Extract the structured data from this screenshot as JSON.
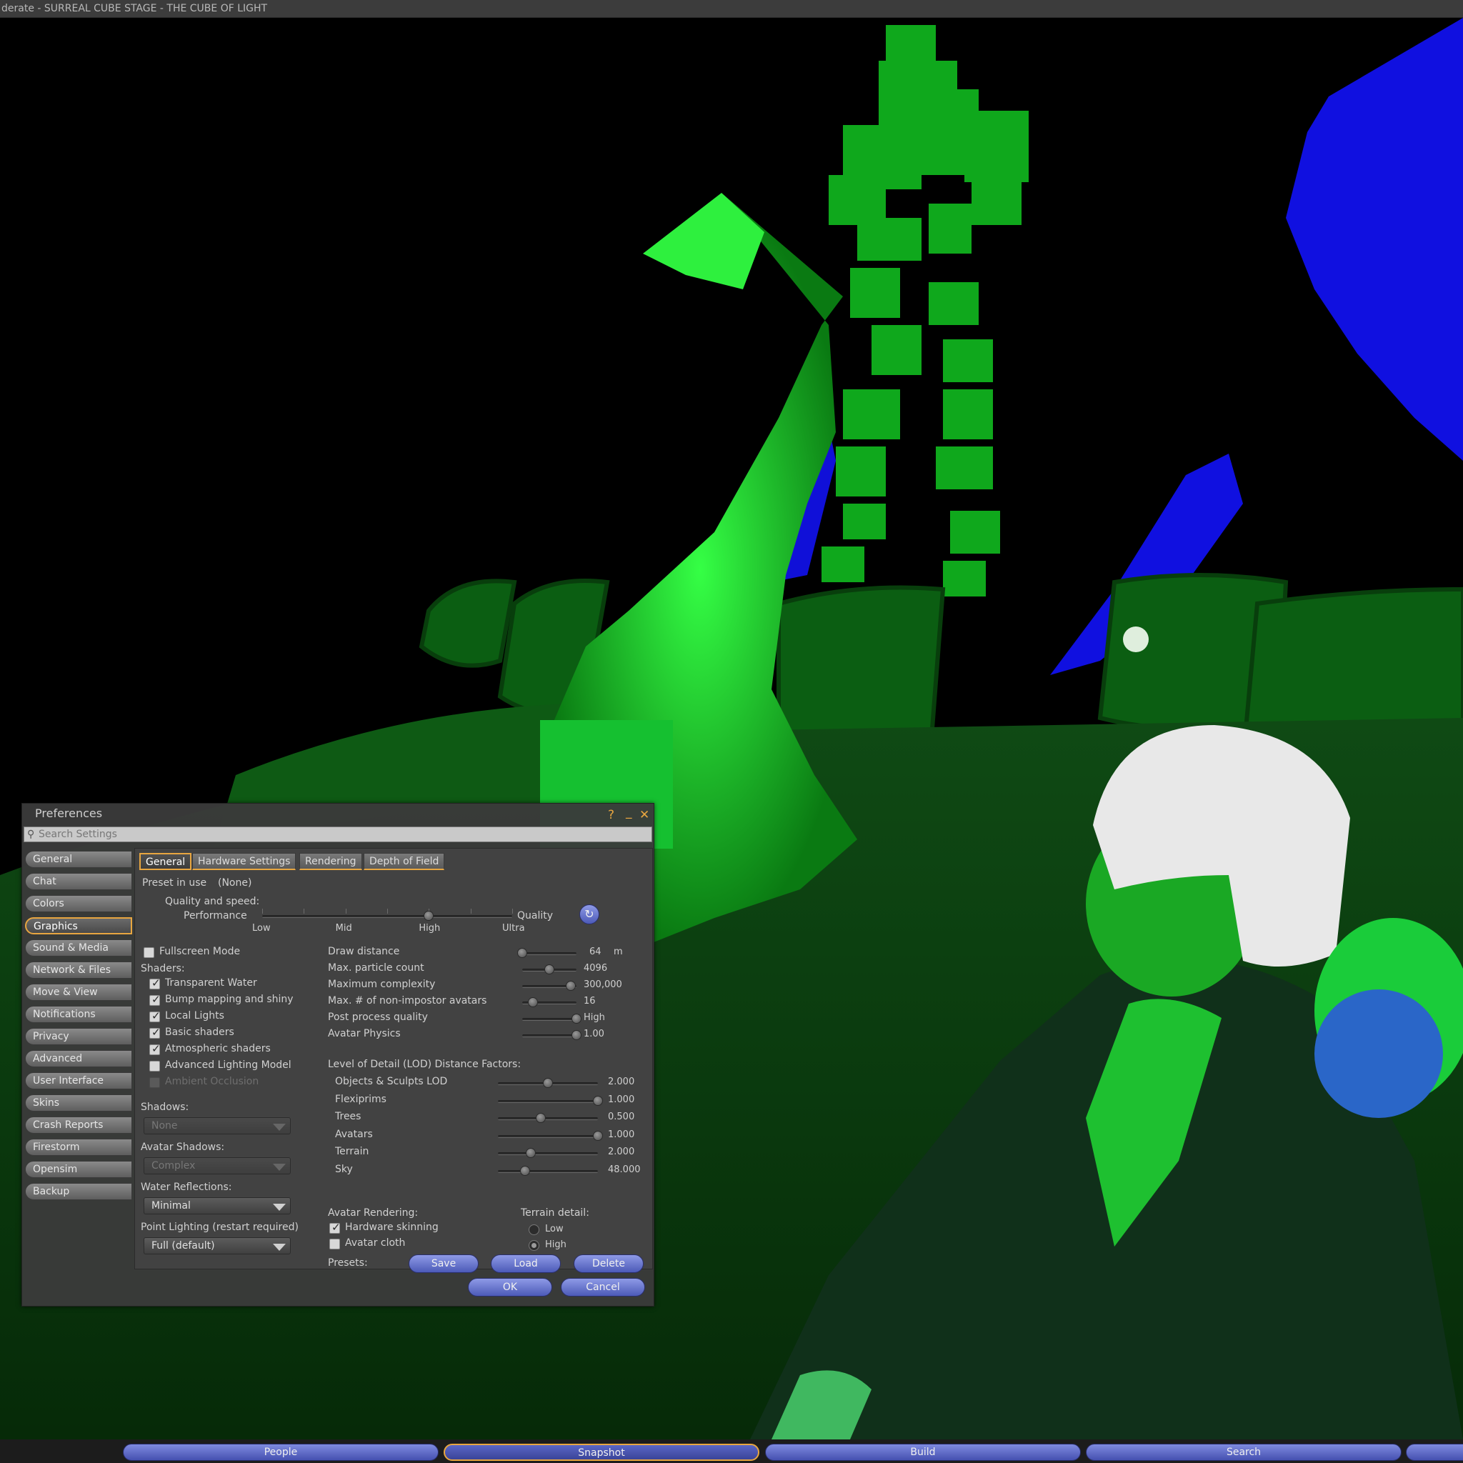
{
  "window": {
    "title": "derate - SURREAL CUBE STAGE - THE CUBE OF LIGHT"
  },
  "prefs": {
    "title": "Preferences",
    "help": "?",
    "minimize": "_",
    "close": "✕",
    "search_placeholder": "Search Settings",
    "sidebar": [
      "General",
      "Chat",
      "Colors",
      "Graphics",
      "Sound & Media",
      "Network & Files",
      "Move & View",
      "Notifications",
      "Privacy",
      "Advanced",
      "User Interface",
      "Skins",
      "Crash Reports",
      "Firestorm",
      "Opensim",
      "Backup"
    ],
    "sidebar_active": "Graphics",
    "tabs": [
      "General",
      "Hardware Settings",
      "Rendering",
      "Depth of Field"
    ],
    "tab_active": "General",
    "preset_label": "Preset in use",
    "preset_value": "(None)",
    "quality": {
      "label": "Quality and speed:",
      "left": "Performance",
      "right": "Quality",
      "ticks": [
        "Low",
        "Mid",
        "High",
        "Ultra"
      ],
      "level": 4,
      "max": 6
    },
    "fullscreen": {
      "label": "Fullscreen Mode",
      "checked": false
    },
    "shaders_label": "Shaders:",
    "shaders": [
      {
        "label": "Transparent Water",
        "checked": true
      },
      {
        "label": "Bump mapping and shiny",
        "checked": true
      },
      {
        "label": "Local Lights",
        "checked": true
      },
      {
        "label": "Basic shaders",
        "checked": true
      },
      {
        "label": "Atmospheric shaders",
        "checked": true
      },
      {
        "label": "Advanced Lighting Model",
        "checked": false
      },
      {
        "label": "Ambient Occlusion",
        "checked": false,
        "disabled": true
      }
    ],
    "shadows": {
      "label": "Shadows:",
      "value": "None"
    },
    "avatar_shadows": {
      "label": "Avatar Shadows:",
      "value": "Complex"
    },
    "water_reflections": {
      "label": "Water Reflections:",
      "value": "Minimal"
    },
    "point_lighting": {
      "label": "Point Lighting (restart required)",
      "value": "Full (default)"
    },
    "sliders": [
      {
        "label": "Draw distance",
        "value": "64",
        "unit": "m",
        "fraction": 0.0
      },
      {
        "label": "Max. particle count",
        "value": "4096",
        "fraction": 0.5
      },
      {
        "label": "Maximum complexity",
        "value": "300,000",
        "fraction": 0.9
      },
      {
        "label": "Max. # of non-impostor avatars",
        "value": "16",
        "fraction": 0.2
      },
      {
        "label": "Post process quality",
        "value": "High",
        "fraction": 1.0
      },
      {
        "label": "Avatar Physics",
        "value": "1.00",
        "fraction": 1.0
      }
    ],
    "lod_label": "Level of Detail (LOD) Distance Factors:",
    "lod": [
      {
        "label": "Objects & Sculpts LOD",
        "value": "2.000",
        "fraction": 0.5
      },
      {
        "label": "Flexiprims",
        "value": "1.000",
        "fraction": 1.0
      },
      {
        "label": "Trees",
        "value": "0.500",
        "fraction": 0.43
      },
      {
        "label": "Avatars",
        "value": "1.000",
        "fraction": 1.0
      },
      {
        "label": "Terrain",
        "value": "2.000",
        "fraction": 0.33
      },
      {
        "label": "Sky",
        "value": "48.000",
        "fraction": 0.27
      }
    ],
    "avatar_rendering": {
      "label": "Avatar Rendering:",
      "hardware_skinning": {
        "label": "Hardware skinning",
        "checked": true
      },
      "avatar_cloth": {
        "label": "Avatar cloth",
        "checked": false
      }
    },
    "terrain_detail": {
      "label": "Terrain detail:",
      "options": [
        "Low",
        "High"
      ],
      "selected": "High"
    },
    "presets_label": "Presets:",
    "presets_buttons": [
      "Save",
      "Load",
      "Delete"
    ],
    "ok": "OK",
    "cancel": "Cancel"
  },
  "toolbar": {
    "buttons": [
      "People",
      "Snapshot",
      "Build",
      "Search"
    ],
    "selected": "Snapshot"
  },
  "colors": {
    "accent": "#e8a640",
    "button_blue": "#5a66c6",
    "scene_green": "#19d82a",
    "scene_blue": "#1010e0"
  }
}
